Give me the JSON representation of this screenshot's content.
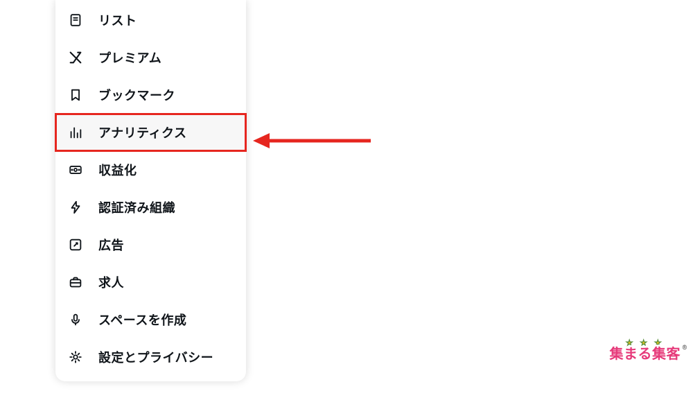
{
  "menu": {
    "items": [
      {
        "key": "lists",
        "icon": "list-icon",
        "label": "リスト"
      },
      {
        "key": "premium",
        "icon": "x-icon",
        "label": "プレミアム"
      },
      {
        "key": "bookmarks",
        "icon": "bookmark-icon",
        "label": "ブックマーク"
      },
      {
        "key": "analytics",
        "icon": "analytics-icon",
        "label": "アナリティクス",
        "highlighted": true
      },
      {
        "key": "monetization",
        "icon": "monetization-icon",
        "label": "収益化"
      },
      {
        "key": "verified-orgs",
        "icon": "bolt-icon",
        "label": "認証済み組織"
      },
      {
        "key": "ads",
        "icon": "ads-icon",
        "label": "広告"
      },
      {
        "key": "jobs",
        "icon": "jobs-icon",
        "label": "求人"
      },
      {
        "key": "create-space",
        "icon": "mic-icon",
        "label": "スペースを作成"
      },
      {
        "key": "settings",
        "icon": "gear-icon",
        "label": "設定とプライバシー"
      }
    ]
  },
  "annotation": {
    "arrow_color": "#e6261f"
  },
  "watermark": {
    "text": "集まる集客",
    "reg": "®"
  }
}
